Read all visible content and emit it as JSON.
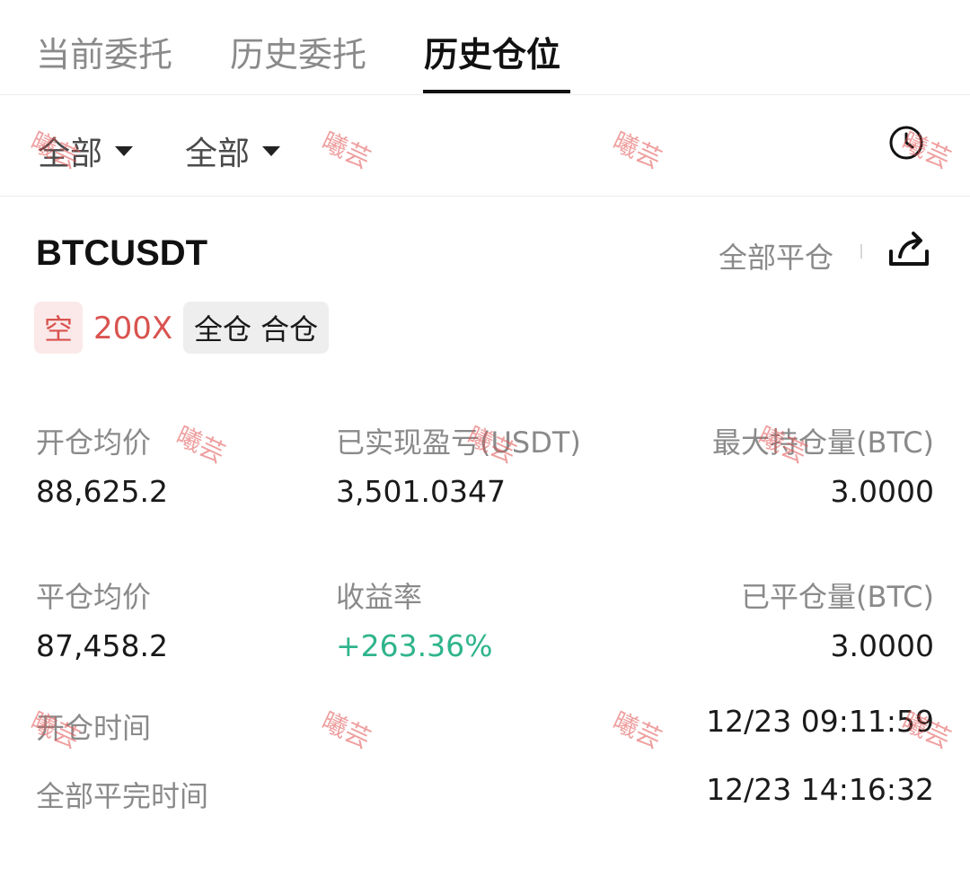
{
  "tabs": [
    {
      "label": "当前委托",
      "active": false
    },
    {
      "label": "历史委托",
      "active": false
    },
    {
      "label": "历史仓位",
      "active": true
    }
  ],
  "filters": [
    {
      "value": "全部"
    },
    {
      "value": "全部"
    }
  ],
  "icons": {
    "history": "clock-icon",
    "share": "share-icon",
    "dropdown": "caret-down-icon"
  },
  "position": {
    "symbol": "BTCUSDT",
    "close_all_label": "全部平仓",
    "side": "空",
    "leverage": "200X",
    "mode": "全仓 合仓"
  },
  "stats": {
    "avg_open_label": "开仓均价",
    "avg_open_value": "88,625.2",
    "realized_pnl_label": "已实现盈亏(USDT)",
    "realized_pnl_value": "3,501.0347",
    "max_hold_label": "最大持仓量(BTC)",
    "max_hold_value": "3.0000",
    "avg_close_label": "平仓均价",
    "avg_close_value": "87,458.2",
    "roi_label": "收益率",
    "roi_value": "+263.36%",
    "closed_qty_label": "已平仓量(BTC)",
    "closed_qty_value": "3.0000",
    "open_time_label": "开仓时间",
    "open_time_value": "12/23 09:11:59",
    "close_time_label": "全部平完时间",
    "close_time_value": "12/23 14:16:32"
  },
  "watermark_text": "曦芸",
  "colors": {
    "short": "#d9534f",
    "profit": "#2fb48b",
    "muted": "#8a8a8a",
    "text": "#1a1a1a"
  }
}
